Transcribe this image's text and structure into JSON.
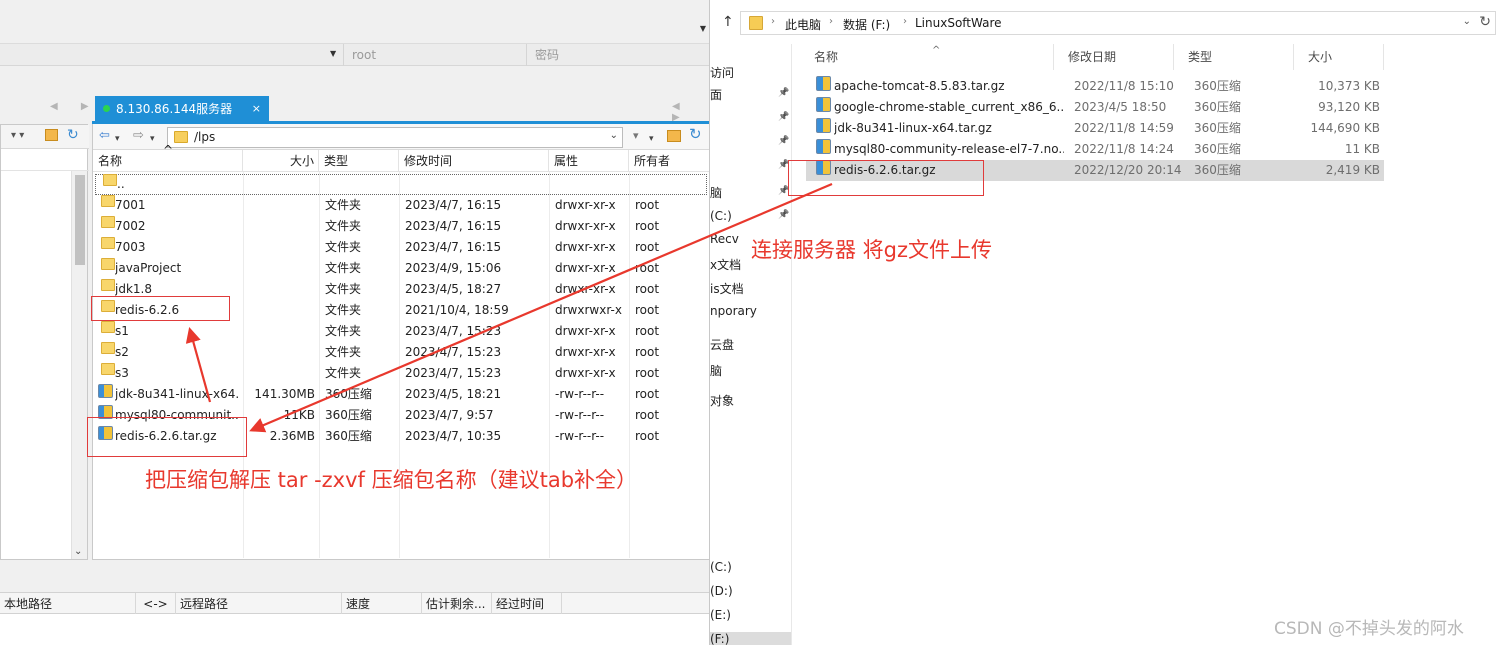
{
  "sftp": {
    "login": {
      "user_value": "root",
      "password_placeholder": "密码"
    },
    "server_tab": {
      "label": "8.130.86.144服务器",
      "close": "×"
    },
    "remote_path": "/lps",
    "columns": {
      "name": "名称",
      "size": "大小",
      "type": "类型",
      "modified": "修改时间",
      "attrs": "属性",
      "owner": "所有者"
    },
    "files": [
      {
        "name": "..",
        "size": "",
        "type": "",
        "modified": "",
        "attrs": "",
        "owner": "",
        "kind": "folder"
      },
      {
        "name": "7001",
        "size": "",
        "type": "文件夹",
        "modified": "2023/4/7, 16:15",
        "attrs": "drwxr-xr-x",
        "owner": "root",
        "kind": "folder"
      },
      {
        "name": "7002",
        "size": "",
        "type": "文件夹",
        "modified": "2023/4/7, 16:15",
        "attrs": "drwxr-xr-x",
        "owner": "root",
        "kind": "folder"
      },
      {
        "name": "7003",
        "size": "",
        "type": "文件夹",
        "modified": "2023/4/7, 16:15",
        "attrs": "drwxr-xr-x",
        "owner": "root",
        "kind": "folder"
      },
      {
        "name": "javaProject",
        "size": "",
        "type": "文件夹",
        "modified": "2023/4/9, 15:06",
        "attrs": "drwxr-xr-x",
        "owner": "root",
        "kind": "folder"
      },
      {
        "name": "jdk1.8",
        "size": "",
        "type": "文件夹",
        "modified": "2023/4/5, 18:27",
        "attrs": "drwxr-xr-x",
        "owner": "root",
        "kind": "folder"
      },
      {
        "name": "redis-6.2.6",
        "size": "",
        "type": "文件夹",
        "modified": "2021/10/4, 18:59",
        "attrs": "drwxrwxr-x",
        "owner": "root",
        "kind": "folder"
      },
      {
        "name": "s1",
        "size": "",
        "type": "文件夹",
        "modified": "2023/4/7, 15:23",
        "attrs": "drwxr-xr-x",
        "owner": "root",
        "kind": "folder"
      },
      {
        "name": "s2",
        "size": "",
        "type": "文件夹",
        "modified": "2023/4/7, 15:23",
        "attrs": "drwxr-xr-x",
        "owner": "root",
        "kind": "folder"
      },
      {
        "name": "s3",
        "size": "",
        "type": "文件夹",
        "modified": "2023/4/7, 15:23",
        "attrs": "drwxr-xr-x",
        "owner": "root",
        "kind": "folder"
      },
      {
        "name": "jdk-8u341-linux-x64...",
        "size": "141.30MB",
        "type": "360压缩",
        "modified": "2023/4/5, 18:21",
        "attrs": "-rw-r--r--",
        "owner": "root",
        "kind": "archive"
      },
      {
        "name": "mysql80-communit...",
        "size": "11KB",
        "type": "360压缩",
        "modified": "2023/4/7, 9:57",
        "attrs": "-rw-r--r--",
        "owner": "root",
        "kind": "archive"
      },
      {
        "name": "redis-6.2.6.tar.gz",
        "size": "2.36MB",
        "type": "360压缩",
        "modified": "2023/4/7, 10:35",
        "attrs": "-rw-r--r--",
        "owner": "root",
        "kind": "archive"
      }
    ],
    "transfer_columns": {
      "local_path": "本地路径",
      "direction": "<->",
      "remote_path": "远程路径",
      "speed": "速度",
      "remaining": "估计剩余...",
      "elapsed": "经过时间"
    }
  },
  "explorer": {
    "breadcrumb": [
      "此电脑",
      "数据 (F:)",
      "LinuxSoftWare"
    ],
    "columns": {
      "name": "名称",
      "modified": "修改日期",
      "type": "类型",
      "size": "大小"
    },
    "nav_items": [
      "访问",
      "面",
      "脑",
      "(C:)",
      "Recv",
      "x文档",
      "is文档",
      "nporary",
      "云盘",
      "脑",
      "对象",
      "(C:)",
      "(D:)",
      "(E:)",
      "(F:)"
    ],
    "files": [
      {
        "name": "apache-tomcat-8.5.83.tar.gz",
        "modified": "2022/11/8 15:10",
        "type": "360压缩",
        "size": "10,373 KB"
      },
      {
        "name": "google-chrome-stable_current_x86_6...",
        "modified": "2023/4/5 18:50",
        "type": "360压缩",
        "size": "93,120 KB"
      },
      {
        "name": "jdk-8u341-linux-x64.tar.gz",
        "modified": "2022/11/8 14:59",
        "type": "360压缩",
        "size": "144,690 KB"
      },
      {
        "name": "mysql80-community-release-el7-7.no...",
        "modified": "2022/11/8 14:24",
        "type": "360压缩",
        "size": "11 KB"
      },
      {
        "name": "redis-6.2.6.tar.gz",
        "modified": "2022/12/20 20:14",
        "type": "360压缩",
        "size": "2,419 KB"
      }
    ],
    "selected_index": 4
  },
  "annotations": {
    "upload_note": "连接服务器 将gz文件上传",
    "extract_note": "把压缩包解压 tar -zxvf 压缩包名称（建议tab补全）",
    "color": "#e8382d"
  },
  "watermark": "CSDN @不掉头发的阿水",
  "colors": {
    "accent_blue": "#1f8fd6",
    "online_green": "#2bd44e",
    "annotation_red": "#e8382d",
    "selection_gray": "#d9d9d9"
  }
}
